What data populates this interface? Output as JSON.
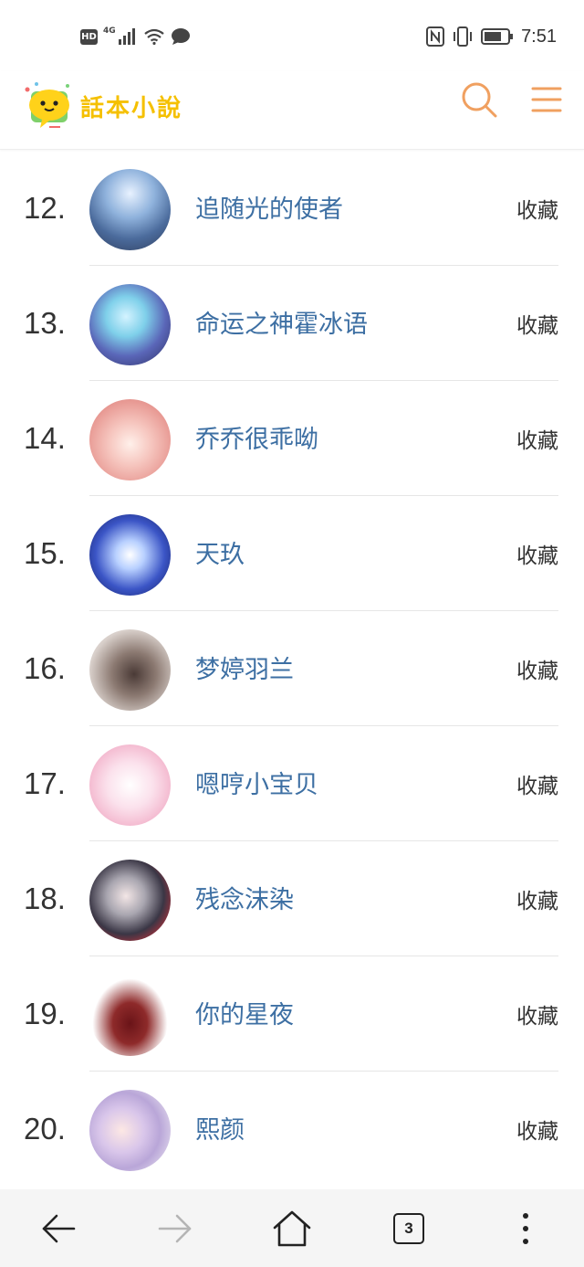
{
  "status_bar": {
    "hd_label": "HD",
    "network_label": "4G",
    "time": "7:51",
    "icons": [
      "signal-icon",
      "wifi-icon",
      "chat-bubble-icon",
      "nfc-icon",
      "vibrate-icon",
      "battery-icon"
    ]
  },
  "header": {
    "logo_text": "話本小說",
    "icons": [
      "search-icon",
      "menu-icon"
    ],
    "accent_color": "#f0a060"
  },
  "list": {
    "action_label": "收藏",
    "items": [
      {
        "rank": "12.",
        "name": "追随光的使者"
      },
      {
        "rank": "13.",
        "name": "命运之神霍冰语"
      },
      {
        "rank": "14.",
        "name": "乔乔很乖呦"
      },
      {
        "rank": "15.",
        "name": "天玖"
      },
      {
        "rank": "16.",
        "name": "梦婷羽兰"
      },
      {
        "rank": "17.",
        "name": "嗯哼小宝贝"
      },
      {
        "rank": "18.",
        "name": "残念沫染"
      },
      {
        "rank": "19.",
        "name": "你的星夜"
      },
      {
        "rank": "20.",
        "name": "熙颜"
      }
    ]
  },
  "bottom_nav": {
    "tab_count": "3",
    "icons": [
      "back-arrow-icon",
      "forward-arrow-icon",
      "home-icon",
      "tabs-icon",
      "more-vertical-icon"
    ]
  }
}
